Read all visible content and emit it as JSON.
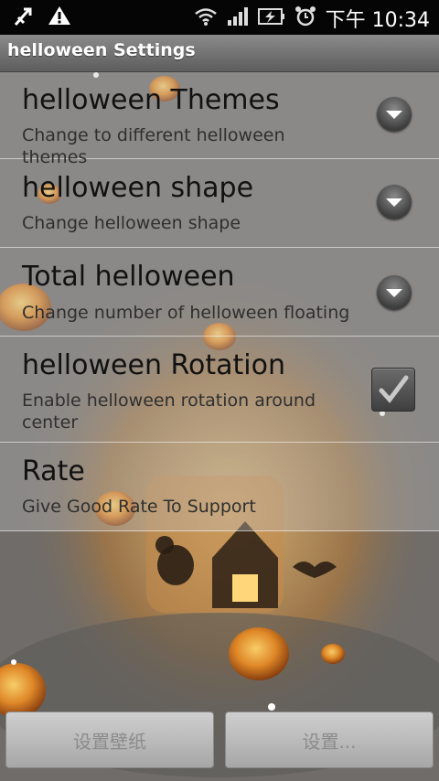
{
  "status_bar": {
    "time": "下午 10:34",
    "icons": [
      "usb-debug-icon",
      "warning-icon",
      "wifi-icon",
      "signal-icon",
      "battery-charging-icon",
      "alarm-icon"
    ]
  },
  "title_bar": {
    "title": "helloween Settings"
  },
  "settings": [
    {
      "title": "helloween Themes",
      "summary": "Change to different helloween themes",
      "control": "dropdown"
    },
    {
      "title": "helloween shape",
      "summary": "Change helloween shape",
      "control": "dropdown"
    },
    {
      "title": "Total helloween",
      "summary": "Change number of helloween floating",
      "control": "dropdown"
    },
    {
      "title": "helloween Rotation",
      "summary": "Enable helloween rotation around center",
      "control": "checkbox",
      "checked": true
    },
    {
      "title": "Rate",
      "summary": "Give Good Rate To Support",
      "control": "none"
    }
  ],
  "buttons": {
    "set_wallpaper": "设置壁纸",
    "settings": "设置..."
  },
  "colors": {
    "status_bar_bg": "#050505",
    "title_bar_bg": "#707070",
    "list_text": "#111111",
    "pumpkin": "#e07a1c"
  }
}
